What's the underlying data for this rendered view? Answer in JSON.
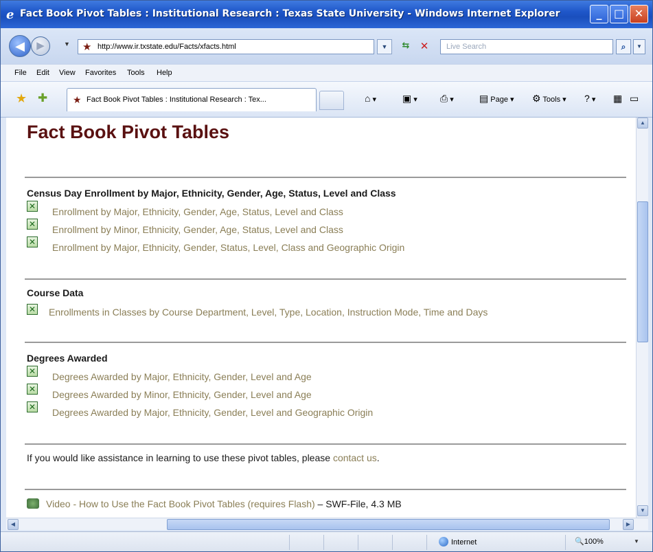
{
  "window": {
    "title": "Fact Book Pivot Tables : Institutional Research : Texas State University - Windows Internet Explorer",
    "min_label": "_",
    "max_label": "□",
    "close_label": "✕"
  },
  "address_bar": {
    "url": "http://www.ir.txstate.edu/Facts/xfacts.html",
    "search_placeholder": "Live Search"
  },
  "menu": [
    "File",
    "Edit",
    "View",
    "Favorites",
    "Tools",
    "Help"
  ],
  "tab": {
    "label": "Fact Book Pivot Tables : Institutional Research : Tex..."
  },
  "toolbar": {
    "page_label": "Page",
    "tools_label": "Tools"
  },
  "page": {
    "title": "Fact Book Pivot Tables",
    "sections": [
      {
        "heading": "Census Day Enrollment by Major, Ethnicity, Gender, Age, Status, Level and Class",
        "links": [
          "Enrollment by Major, Ethnicity, Gender, Age, Status, Level and Class",
          "Enrollment by Minor, Ethnicity, Gender, Age, Status, Level and Class",
          "Enrollment by Major, Ethnicity, Gender, Status, Level, Class and Geographic Origin"
        ]
      },
      {
        "heading": "Course Data",
        "links": [
          "Enrollments in Classes by Course Department, Level, Type, Location, Instruction Mode, Time and Days"
        ]
      },
      {
        "heading": "Degrees Awarded",
        "links": [
          "Degrees Awarded by Major, Ethnicity, Gender, Level and Age",
          "Degrees Awarded by Minor, Ethnicity, Gender, Level and Age",
          "Degrees Awarded by Major, Ethnicity, Gender, Level and Geographic Origin"
        ]
      }
    ],
    "assist_text": "If you would like assistance in learning to use these pivot tables, please ",
    "assist_link": "contact us",
    "assist_end": ".",
    "video_link": "Video - How to Use the Fact Book Pivot Tables (requires Flash)",
    "video_info": " – SWF-File, 4.3 MB"
  },
  "status": {
    "zone": "Internet",
    "zoom": "100%"
  }
}
